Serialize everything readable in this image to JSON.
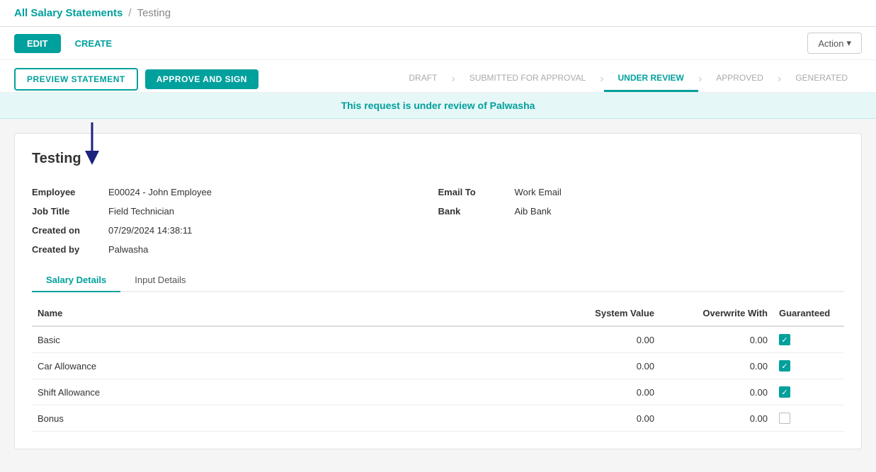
{
  "breadcrumb": {
    "parent": "All Salary Statements",
    "separator": "/",
    "current": "Testing"
  },
  "toolbar": {
    "edit_label": "EDIT",
    "create_label": "CREATE",
    "action_label": "Action",
    "action_arrow": "▾"
  },
  "workflow": {
    "preview_label": "PREVIEW STATEMENT",
    "approve_label": "APPROVE AND SIGN",
    "steps": [
      {
        "label": "DRAFT",
        "active": false
      },
      {
        "label": "SUBMITTED FOR APPROVAL",
        "active": false
      },
      {
        "label": "UNDER REVIEW",
        "active": true
      },
      {
        "label": "APPROVED",
        "active": false
      },
      {
        "label": "GENERATED",
        "active": false
      }
    ]
  },
  "review_banner": {
    "message": "This request is under review of Palwasha"
  },
  "form": {
    "title": "Testing",
    "left": {
      "employee_label": "Employee",
      "employee_value": "E00024 - John Employee",
      "job_title_label": "Job Title",
      "job_title_value": "Field Technician",
      "created_on_label": "Created on",
      "created_on_value": "07/29/2024 14:38:11",
      "created_by_label": "Created by",
      "created_by_value": "Palwasha"
    },
    "right": {
      "email_to_label": "Email To",
      "email_to_value": "Work Email",
      "bank_label": "Bank",
      "bank_value": "Aib Bank"
    }
  },
  "tabs": [
    {
      "label": "Salary Details",
      "active": true
    },
    {
      "label": "Input Details",
      "active": false
    }
  ],
  "table": {
    "columns": [
      "Name",
      "System Value",
      "Overwrite With",
      "Guaranteed"
    ],
    "rows": [
      {
        "name": "Basic",
        "system_value": "0.00",
        "overwrite_with": "0.00",
        "guaranteed": true
      },
      {
        "name": "Car Allowance",
        "system_value": "0.00",
        "overwrite_with": "0.00",
        "guaranteed": true
      },
      {
        "name": "Shift Allowance",
        "system_value": "0.00",
        "overwrite_with": "0.00",
        "guaranteed": true
      },
      {
        "name": "Bonus",
        "system_value": "0.00",
        "overwrite_with": "0.00",
        "guaranteed": false
      }
    ]
  }
}
